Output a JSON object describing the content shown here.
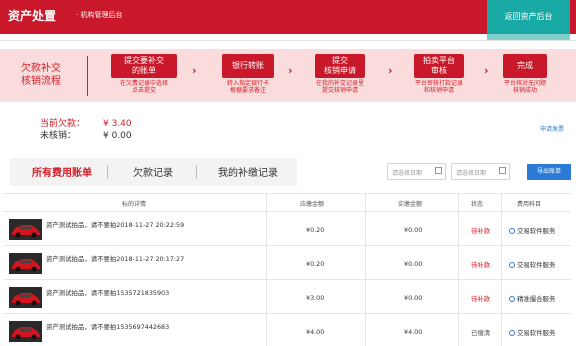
{
  "header": {
    "logo": "资产处置",
    "subtitle": "· 机构管理后台",
    "back_button": "返回资产后台"
  },
  "flow": {
    "title_line1": "欠款补交",
    "title_line2": "核销流程",
    "steps": [
      {
        "label_line1": "提交要补交",
        "label_line2": "的账单",
        "desc_line1": "在欠费记录中选择",
        "desc_line2": "点击提交"
      },
      {
        "label_line1": "银行转账",
        "label_line2": "",
        "desc_line1": "转入指定银行卡",
        "desc_line2": "根据要求备注"
      },
      {
        "label_line1": "提交",
        "label_line2": "核销申请",
        "desc_line1": "在我的补交记录里",
        "desc_line2": "提交核销申请"
      },
      {
        "label_line1": "拍卖平台",
        "label_line2": "审核",
        "desc_line1": "平台审核打款记录",
        "desc_line2": "和核销申请"
      },
      {
        "label_line1": "完成",
        "label_line2": "",
        "desc_line1": "平台核对无问题",
        "desc_line2": "核销成功"
      }
    ],
    "arrow": "›"
  },
  "balance": {
    "owed_label": "当前欠款：",
    "owed_value": "¥ 3.40",
    "unwritten_label": "未核销：",
    "unwritten_value": "¥ 0.00",
    "apply_link": "申请发票"
  },
  "tabs": [
    {
      "label": "所有费用账单",
      "active": true
    },
    {
      "label": "欠款记录",
      "active": false
    },
    {
      "label": "我的补缴记录",
      "active": false
    }
  ],
  "filters": {
    "start_placeholder": "请选择日期",
    "end_placeholder": "请选择日期",
    "export_label": "导出账单"
  },
  "table": {
    "headers": [
      "标的详情",
      "应缴金额",
      "实缴金额",
      "状态",
      "费用科目"
    ],
    "rows": [
      {
        "title": "资产测试拍品，请不要拍2018-11-27 20:22:59",
        "due": "¥0.20",
        "paid": "¥0.00",
        "status": "待补款",
        "fee": "交易软件服务"
      },
      {
        "title": "资产测试拍品，请不要拍2018-11-27 20:17:27",
        "due": "¥0.20",
        "paid": "¥0.00",
        "status": "待补款",
        "fee": "交易软件服务"
      },
      {
        "title": "资产测试拍品，请不要拍1535721835903",
        "due": "¥3.00",
        "paid": "¥0.00",
        "status": "待补款",
        "fee": "精准撮合服务"
      },
      {
        "title": "资产测试拍品，请不要拍1535697442683",
        "due": "¥4.00",
        "paid": "¥4.00",
        "status": "已缴清",
        "fee": "交易软件服务"
      }
    ]
  },
  "colors": {
    "brand_red": "#c9182a",
    "teal": "#1aaaa5",
    "link_blue": "#2b7bd6",
    "banner_pink": "#fbdcdc"
  }
}
